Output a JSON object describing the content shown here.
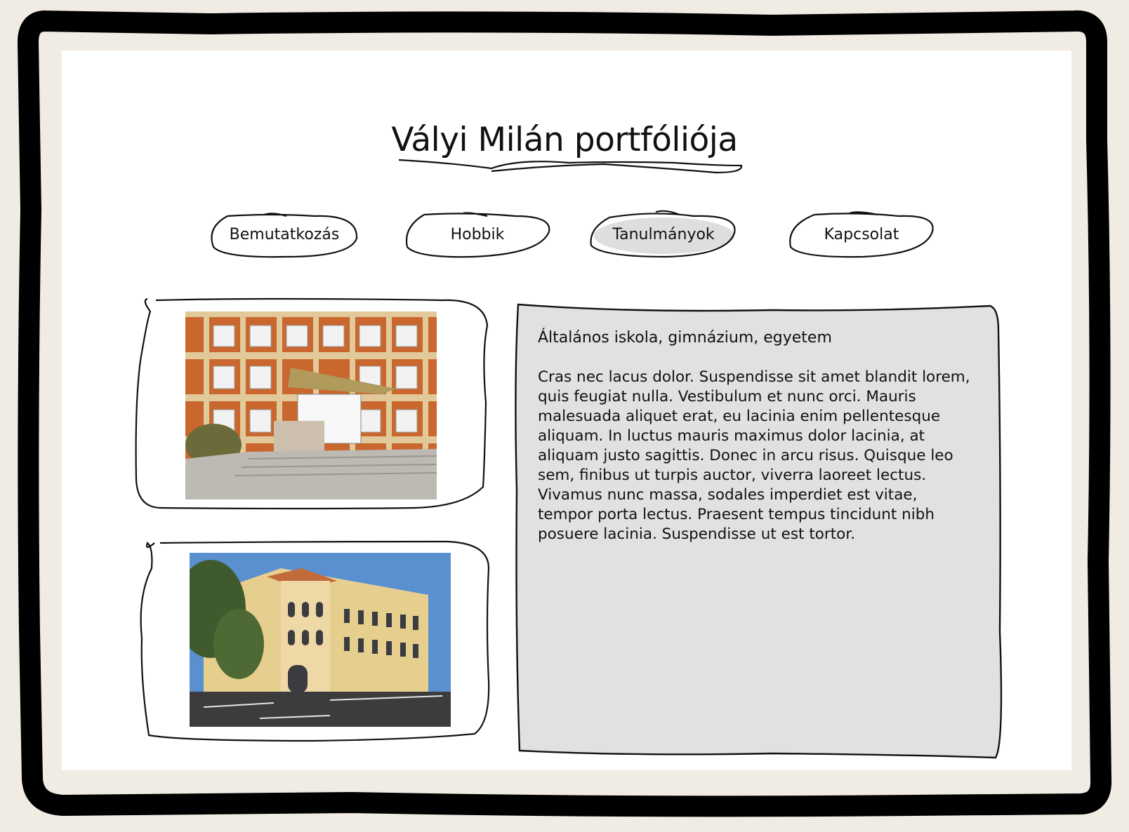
{
  "page": {
    "title": "Vályi Milán portfóliója"
  },
  "nav": {
    "items": [
      {
        "label": "Bemutatkozás",
        "active": false
      },
      {
        "label": "Hobbik",
        "active": false
      },
      {
        "label": "Tanulmányok",
        "active": true
      },
      {
        "label": "Kapcsolat",
        "active": false
      }
    ]
  },
  "content": {
    "heading": "Általános iskola, gimnázium, egyetem",
    "body": "Cras nec lacus dolor. Suspendisse sit amet blandit lorem, quis feugiat nulla. Vestibulum et nunc orci. Mauris malesuada aliquet erat, eu lacinia enim pellentesque aliquam. In luctus mauris maximus dolor lacinia, at aliquam justo sagittis. Donec in arcu risus. Quisque leo sem, finibus ut turpis auctor, viverra laoreet lectus. Vivamus nunc massa, sodales imperdiet est vitae, tempor porta lectus. Praesent tempus tincidunt nibh posuere lacinia. Suspendisse ut est tortor."
  },
  "images": [
    {
      "name": "elementary-school-photo"
    },
    {
      "name": "high-school-photo"
    }
  ],
  "colors": {
    "background": "#f1ece3",
    "page": "#ffffff",
    "panel": "#e1e1e1",
    "stroke": "#111111"
  }
}
